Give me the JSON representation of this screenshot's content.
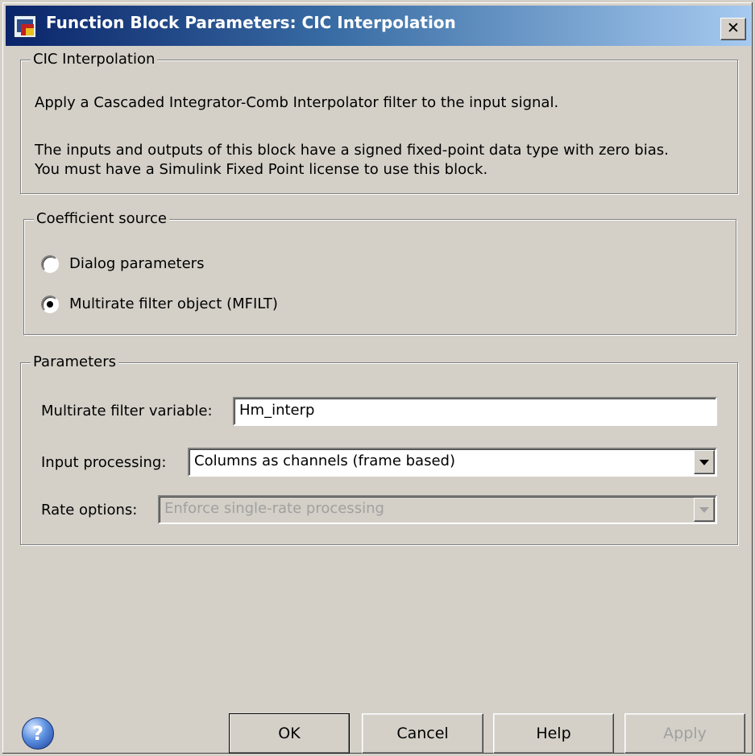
{
  "window": {
    "title": "Function Block Parameters: CIC Interpolation",
    "close_label": "✕"
  },
  "description_group": {
    "legend": "CIC Interpolation",
    "line1": "Apply a Cascaded Integrator-Comb Interpolator filter to the input signal.",
    "line2": "The inputs and outputs of this block have a signed fixed-point data type with zero bias.",
    "line3": "You must have a Simulink Fixed Point license to use this block."
  },
  "coefficient_group": {
    "legend": "Coefficient source",
    "options": [
      {
        "label": "Dialog parameters",
        "selected": false
      },
      {
        "label": "Multirate filter object (MFILT)",
        "selected": true
      }
    ]
  },
  "parameters_group": {
    "legend": "Parameters",
    "filter_variable_label": "Multirate filter variable:",
    "filter_variable_value": "Hm_interp",
    "input_processing_label": "Input processing:",
    "input_processing_value": "Columns as channels (frame based)",
    "rate_options_label": "Rate options:",
    "rate_options_value": "Enforce single-rate processing"
  },
  "buttons": {
    "help_icon": "?",
    "ok": "OK",
    "cancel": "Cancel",
    "help": "Help",
    "apply": "Apply"
  },
  "icons": {
    "window_icon": "simulink-block-icon",
    "dropdown": "chevron-down-icon",
    "help": "help-icon"
  }
}
